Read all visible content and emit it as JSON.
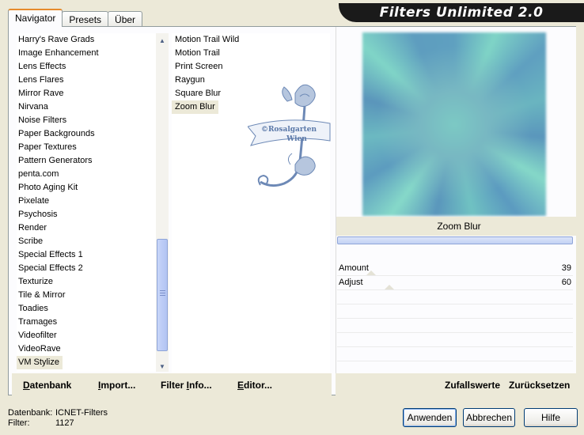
{
  "banner": {
    "title": "Filters Unlimited 2.0"
  },
  "tabs": [
    {
      "label": "Navigator",
      "active": true
    },
    {
      "label": "Presets",
      "active": false
    },
    {
      "label": "Über",
      "active": false
    }
  ],
  "categories": [
    "Harry's Rave Grads",
    "Image Enhancement",
    "Lens Effects",
    "Lens Flares",
    "Mirror Rave",
    "Nirvana",
    "Noise Filters",
    "Paper Backgrounds",
    "Paper Textures",
    "Pattern Generators",
    "penta.com",
    "Photo Aging Kit",
    "Pixelate",
    "Psychosis",
    "Render",
    "Scribe",
    "Special Effects 1",
    "Special Effects 2",
    "Texturize",
    "Tile & Mirror",
    "Toadies",
    "Tramages",
    "Videofilter",
    "VideoRave",
    "VM Stylize"
  ],
  "selected_category": "VM Stylize",
  "filters": [
    "Motion Trail Wild",
    "Motion Trail",
    "Print Screen",
    "Raygun",
    "Square Blur",
    "Zoom Blur"
  ],
  "selected_filter": "Zoom Blur",
  "stamp": {
    "line1": "©Rosalgarten",
    "line2": "Wien"
  },
  "preview": {
    "filter_name": "Zoom Blur"
  },
  "params": [
    {
      "label": "Amount",
      "value": "39"
    },
    {
      "label": "Adjust",
      "value": "60"
    }
  ],
  "toolbar_left": [
    {
      "label": "Datenbank",
      "underline": "D",
      "rest": "atenbank"
    },
    {
      "label": "Import...",
      "underline": "I",
      "rest": "mport..."
    },
    {
      "label": "Filter Info...",
      "pre": "Filter ",
      "underline": "I",
      "rest": "nfo..."
    },
    {
      "label": "Editor...",
      "underline": "E",
      "rest": "ditor..."
    }
  ],
  "toolbar_right": {
    "random": "Zufallswerte",
    "reset": "Zurücksetzen"
  },
  "status": {
    "db_label": "Datenbank:",
    "db_value": "ICNET-Filters",
    "filter_label": "Filter:",
    "filter_value": "1127"
  },
  "buttons": {
    "apply": "Anwenden",
    "cancel": "Abbrechen",
    "help": "Hilfe"
  },
  "colors": {
    "window_bg": "#ece9d8",
    "selection_bg": "#ece9d8",
    "accent_tab": "#e68b2c",
    "preview_teal": "#7fd4c6",
    "preview_blue": "#5fa0c0"
  }
}
